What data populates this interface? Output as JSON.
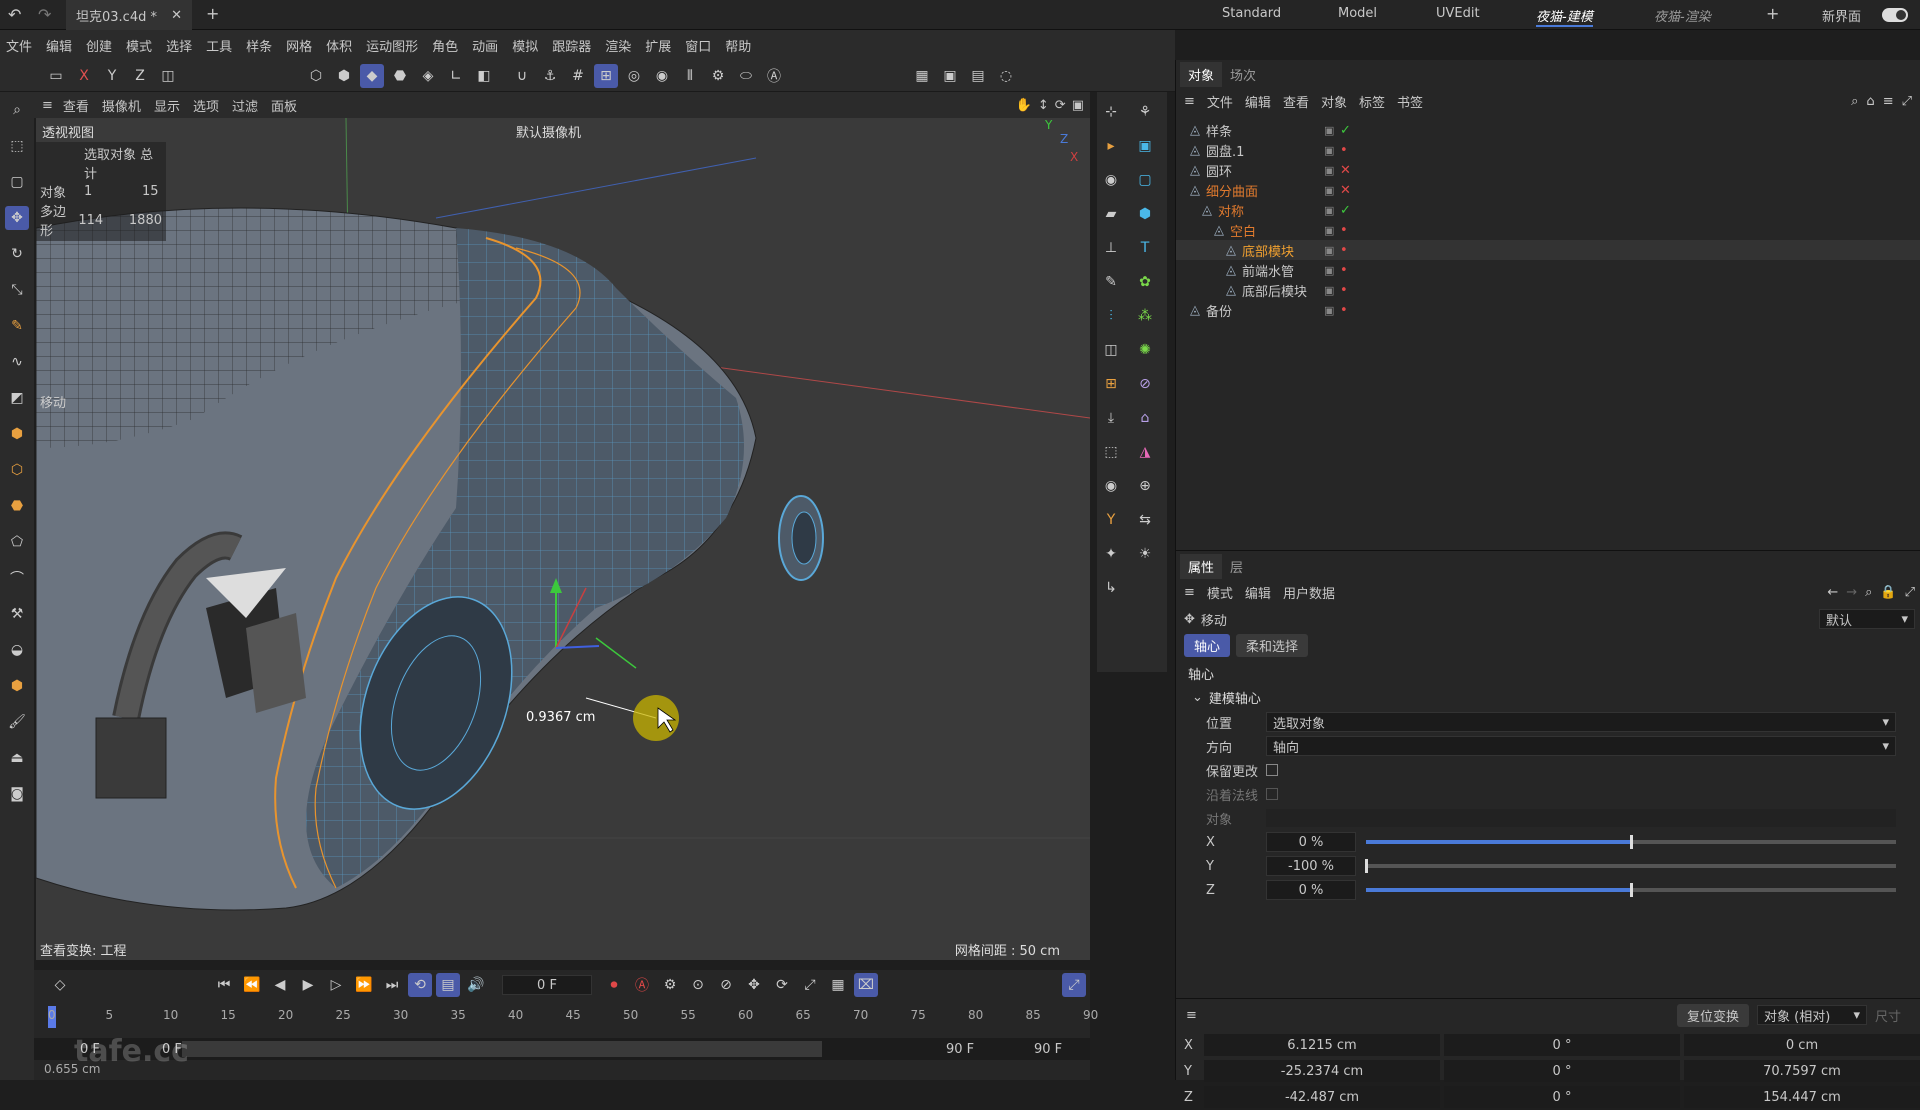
{
  "titlebar": {
    "tab_title": "坦克03.c4d *",
    "layouts": [
      "Standard",
      "Model",
      "UVEdit",
      "夜猫-建模",
      "夜猫-渲染"
    ],
    "active_layout": "夜猫-建模",
    "new_ui": "新界面"
  },
  "menu": [
    "文件",
    "编辑",
    "创建",
    "模式",
    "选择",
    "工具",
    "样条",
    "网格",
    "体积",
    "运动图形",
    "角色",
    "动画",
    "模拟",
    "跟踪器",
    "渲染",
    "扩展",
    "窗口",
    "帮助"
  ],
  "axis_tools": {
    "x": "X",
    "y": "Y",
    "z": "Z"
  },
  "viewport": {
    "menu": [
      "查看",
      "摄像机",
      "显示",
      "选项",
      "过滤",
      "面板"
    ],
    "name": "透视视图",
    "camera": "默认摄像机",
    "stats": {
      "header": "选取对象 总计",
      "obj_label": "对象",
      "obj_sel": "1",
      "obj_total": "15",
      "poly_label": "多边形",
      "poly_sel": "114",
      "poly_total": "1880"
    },
    "tool_label": "移动",
    "measure": "0.9367 cm",
    "footer_left": "查看变换: 工程",
    "footer_right": "网格间距 : 50 cm",
    "axis_gizmo": {
      "y": "Y",
      "z": "Z",
      "x": "X"
    }
  },
  "timeline": {
    "frame": "0 F",
    "ticks": [
      "0",
      "5",
      "10",
      "15",
      "20",
      "25",
      "30",
      "35",
      "40",
      "45",
      "50",
      "55",
      "60",
      "65",
      "70",
      "75",
      "80",
      "85",
      "90"
    ],
    "start": "0 F",
    "start2": "0 F",
    "end": "90 F",
    "end2": "90 F",
    "status": "0.655 cm",
    "watermark": "tafe.cc"
  },
  "objects": {
    "tabs": [
      "对象",
      "场次"
    ],
    "menu": [
      "文件",
      "编辑",
      "查看",
      "对象",
      "标签",
      "书签"
    ],
    "items": [
      {
        "name": "样条",
        "indent": 0,
        "color": "#c8c8c8",
        "status": "check"
      },
      {
        "name": "圆盘.1",
        "indent": 0,
        "color": "#c8c8c8",
        "status": "dot"
      },
      {
        "name": "圆环",
        "indent": 0,
        "color": "#c8c8c8",
        "status": "x"
      },
      {
        "name": "细分曲面",
        "indent": 0,
        "color": "#e07a2e",
        "status": "x"
      },
      {
        "name": "对称",
        "indent": 1,
        "color": "#e07a2e",
        "status": "check"
      },
      {
        "name": "空白",
        "indent": 2,
        "color": "#e07a2e",
        "status": "dot"
      },
      {
        "name": "底部模块",
        "indent": 3,
        "color": "#f0a030",
        "status": "dot"
      },
      {
        "name": "前端水管",
        "indent": 3,
        "color": "#c8c8c8",
        "status": "dot"
      },
      {
        "name": "底部后模块",
        "indent": 3,
        "color": "#c8c8c8",
        "status": "dot"
      },
      {
        "name": "备份",
        "indent": 0,
        "color": "#c8c8c8",
        "status": "dot"
      }
    ]
  },
  "attributes": {
    "tabs": [
      "属性",
      "层"
    ],
    "menu": [
      "模式",
      "编辑",
      "用户数据"
    ],
    "tool": "移动",
    "preset": "默认",
    "subtabs": [
      "轴心",
      "柔和选择"
    ],
    "section": "轴心",
    "group": "建模轴心",
    "position_label": "位置",
    "position_value": "选取对象",
    "direction_label": "方向",
    "direction_value": "轴向",
    "keep_label": "保留更改",
    "along_normal_label": "沿着法线",
    "object_label": "对象",
    "sliders": [
      {
        "axis": "X",
        "value": "0 %",
        "level": 0.5
      },
      {
        "axis": "Y",
        "value": "-100 %",
        "level": 0.0
      },
      {
        "axis": "Z",
        "value": "0 %",
        "level": 0.5
      }
    ]
  },
  "coords": {
    "reset": "复位变换",
    "mode": "对象 (相对)",
    "size": "尺寸",
    "rows": [
      {
        "axis": "X",
        "pos": "6.1215 cm",
        "rot": "0 °",
        "scale": "0 cm"
      },
      {
        "axis": "Y",
        "pos": "-25.2374 cm",
        "rot": "0 °",
        "scale": "70.7597 cm"
      },
      {
        "axis": "Z",
        "pos": "-42.487 cm",
        "rot": "0 °",
        "scale": "154.447 cm"
      }
    ]
  },
  "colors": {
    "accent": "#4a5aa8",
    "orange": "#e07a2e",
    "mesh": "#5aa8d8"
  }
}
